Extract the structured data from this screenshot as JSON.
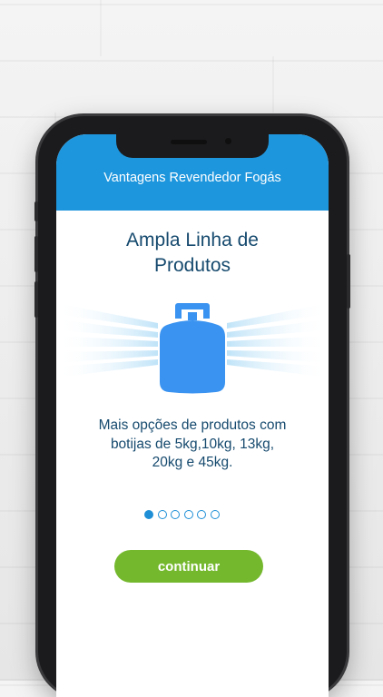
{
  "header": {
    "title": "Vantagens Revendedor Fogás"
  },
  "slide": {
    "title_line1": "Ampla Linha de",
    "title_line2": "Produtos",
    "icon": "gas-cylinder-icon",
    "desc_line1": "Mais opções de produtos com",
    "desc_line2": "botijas de 5kg,10kg, 13kg,",
    "desc_line3": "20kg e 45kg."
  },
  "pagination": {
    "total": 6,
    "current": 1
  },
  "actions": {
    "continue_label": "continuar"
  },
  "colors": {
    "header": "#1e96dd",
    "title_text": "#164a6e",
    "icon": "#3a93f0",
    "button": "#74b82d",
    "dots": "#1e8fd6"
  }
}
